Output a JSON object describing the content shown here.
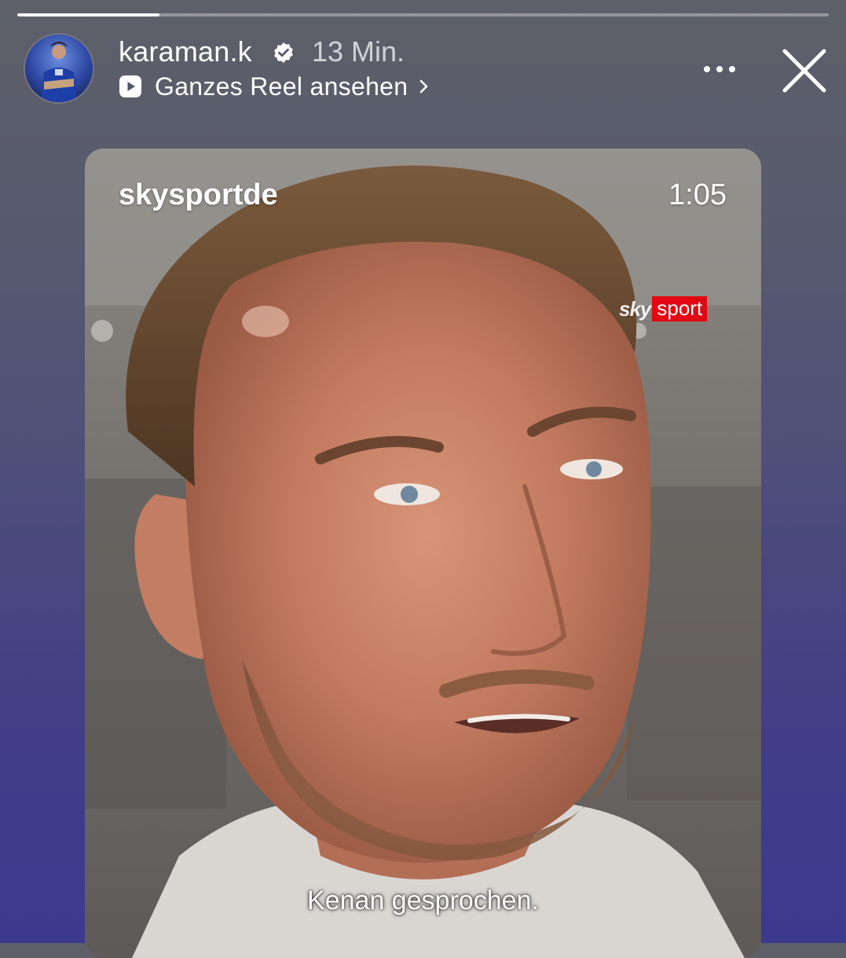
{
  "story": {
    "progress_fraction": 0.175,
    "username": "karaman.k",
    "verified": true,
    "time_ago": "13 Min.",
    "reel_link_label": "Ganzes Reel ansehen",
    "icons": {
      "verified": "verified-badge-icon",
      "reel": "reel-play-icon",
      "chevron": "chevron-right-icon",
      "more": "more-dots-icon",
      "close": "close-icon"
    }
  },
  "video": {
    "channel": "skysportde",
    "duration": "1:05",
    "logo": {
      "sky": "sky",
      "sport": "sport"
    },
    "subtitle": "Kenan gesprochen."
  },
  "colors": {
    "sport_badge": "#e30613",
    "background_top": "#5d6068",
    "background_bottom": "#3b3a8e"
  }
}
